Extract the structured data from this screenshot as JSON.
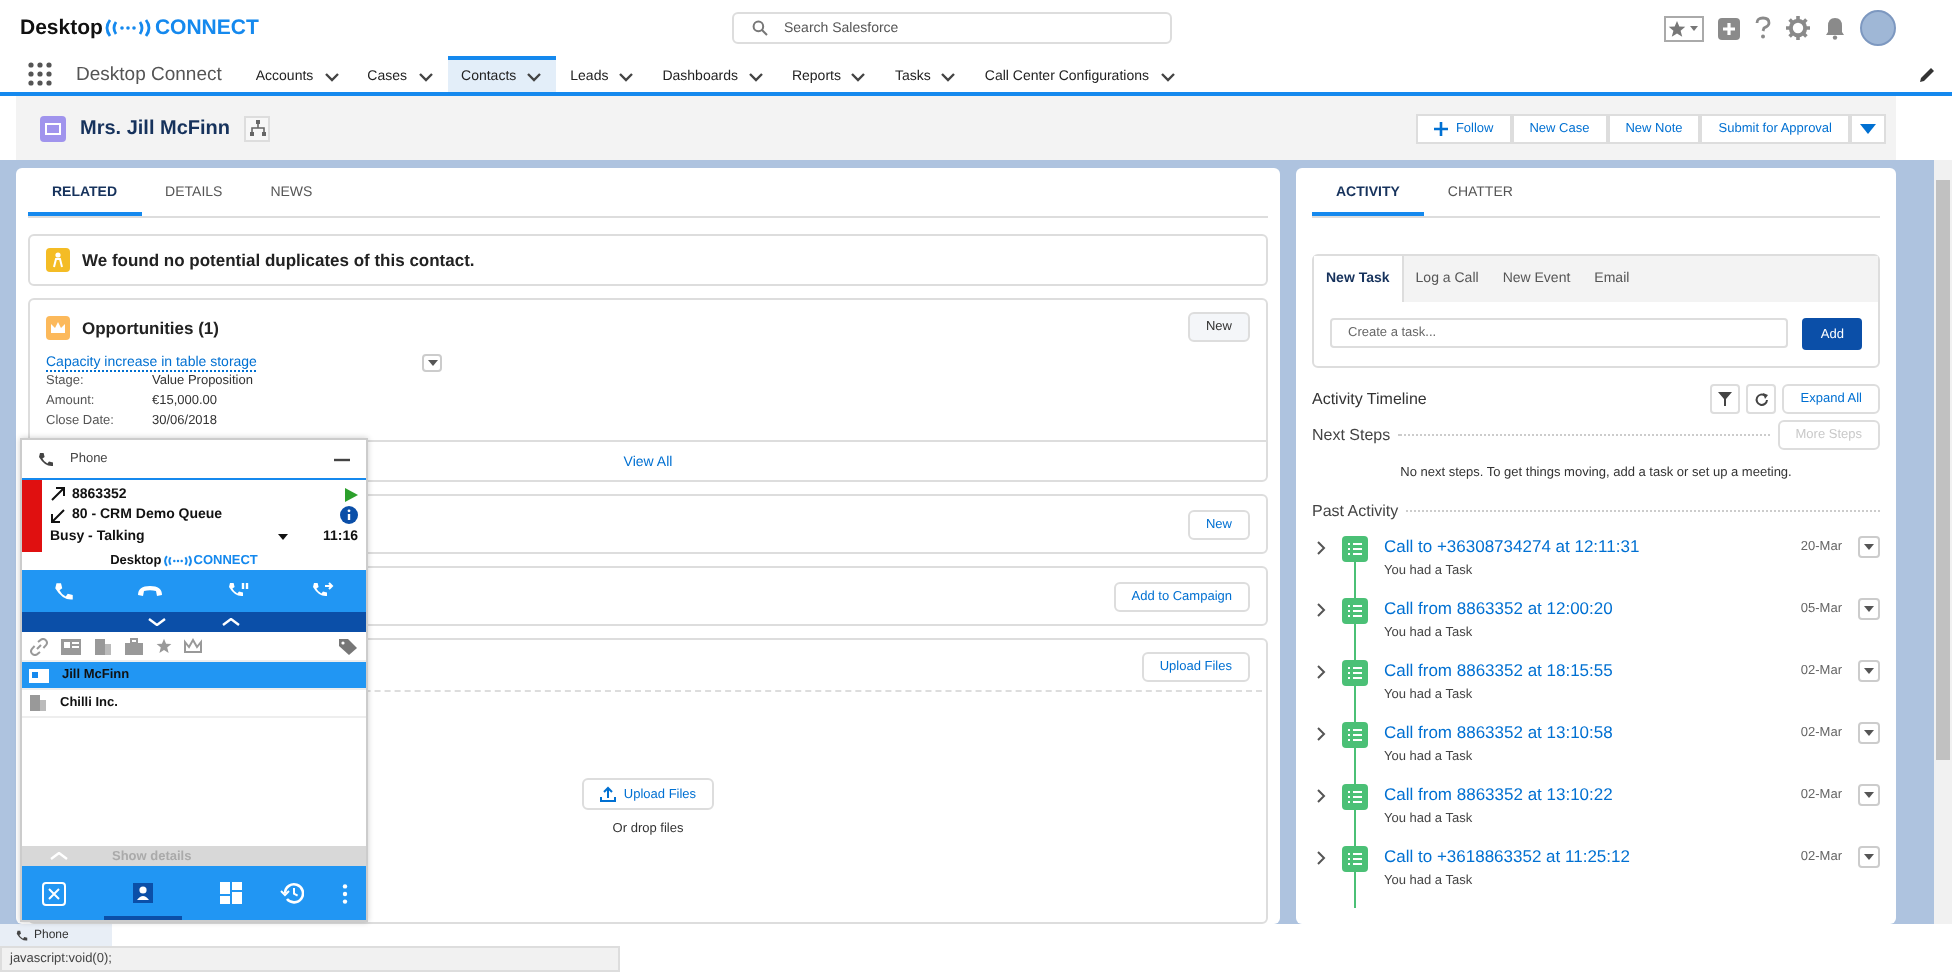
{
  "header": {
    "logo": {
      "dark": "Desktop",
      "light": "CONNECT"
    },
    "search": {
      "placeholder": "Search Salesforce"
    }
  },
  "nav": {
    "app_name": "Desktop Connect",
    "items": [
      {
        "label": "Accounts",
        "selected": false
      },
      {
        "label": "Cases",
        "selected": false
      },
      {
        "label": "Contacts",
        "selected": true
      },
      {
        "label": "Leads",
        "selected": false
      },
      {
        "label": "Dashboards",
        "selected": false
      },
      {
        "label": "Reports",
        "selected": false
      },
      {
        "label": "Tasks",
        "selected": false
      },
      {
        "label": "Call Center Configurations",
        "selected": false
      }
    ]
  },
  "record": {
    "title": "Mrs. Jill McFinn",
    "follow": "Follow",
    "actions": [
      "New Case",
      "New Note",
      "Submit for Approval"
    ]
  },
  "related": {
    "tabs": [
      {
        "label": "RELATED",
        "selected": true
      },
      {
        "label": "DETAILS",
        "selected": false
      },
      {
        "label": "NEWS",
        "selected": false
      }
    ],
    "duplicates_notice": "We found no potential duplicates of this contact.",
    "opportunities": {
      "title": "Opportunities (1)",
      "button": "New",
      "record": {
        "name": "Capacity increase in table storage",
        "fields": [
          {
            "label": "Stage:",
            "value": "Value Proposition"
          },
          {
            "label": "Amount:",
            "value": "€15,000.00"
          },
          {
            "label": "Close Date:",
            "value": "30/06/2018"
          }
        ]
      },
      "view_all": "View All"
    },
    "sections": [
      {
        "kind": "plain",
        "button": "New"
      },
      {
        "kind": "plain",
        "button": "Add to Campaign"
      },
      {
        "kind": "files",
        "button": "Upload Files",
        "upload_button": "Upload Files",
        "drop_hint": "Or drop files"
      }
    ]
  },
  "phone": {
    "title": "Phone",
    "call": {
      "number": "8863352",
      "queue": "80 - CRM Demo Queue",
      "status": "Busy - Talking",
      "timer": "11:16"
    },
    "logo": {
      "dark": "Desktop",
      "light": "CONNECT"
    },
    "matches": [
      {
        "label": "Jill McFinn",
        "kind": "contact",
        "selected": true
      },
      {
        "label": "Chilli Inc.",
        "kind": "account",
        "selected": false
      }
    ],
    "show_details": "Show details"
  },
  "activity": {
    "tabs": [
      {
        "label": "ACTIVITY",
        "selected": true
      },
      {
        "label": "CHATTER",
        "selected": false
      }
    ],
    "composer_tabs": [
      {
        "label": "New Task",
        "selected": true
      },
      {
        "label": "Log a Call",
        "selected": false
      },
      {
        "label": "New Event",
        "selected": false
      },
      {
        "label": "Email",
        "selected": false
      }
    ],
    "task_input": {
      "placeholder": "Create a task..."
    },
    "add_button": "Add",
    "timeline_title": "Activity Timeline",
    "expand_all": "Expand All",
    "next_steps": {
      "label": "Next Steps",
      "button": "More Steps",
      "disabled": true,
      "empty_text": "No next steps. To get things moving, add a task or set up a meeting."
    },
    "past_label": "Past Activity",
    "items": [
      {
        "title": "Call to +36308734274 at 12:11:31",
        "subtitle": "You had a Task",
        "date": "20-Mar"
      },
      {
        "title": "Call from 8863352 at 12:00:20",
        "subtitle": "You had a Task",
        "date": "05-Mar"
      },
      {
        "title": "Call from 8863352 at 18:15:55",
        "subtitle": "You had a Task",
        "date": "02-Mar"
      },
      {
        "title": "Call from 8863352 at 13:10:58",
        "subtitle": "You had a Task",
        "date": "02-Mar"
      },
      {
        "title": "Call from 8863352 at 13:10:22",
        "subtitle": "You had a Task",
        "date": "02-Mar"
      },
      {
        "title": "Call to +3618863352 at 11:25:12",
        "subtitle": "You had a Task",
        "date": "02-Mar"
      }
    ]
  },
  "utility_bar": {
    "label": "Phone"
  },
  "status_bar": "javascript:void(0);"
}
